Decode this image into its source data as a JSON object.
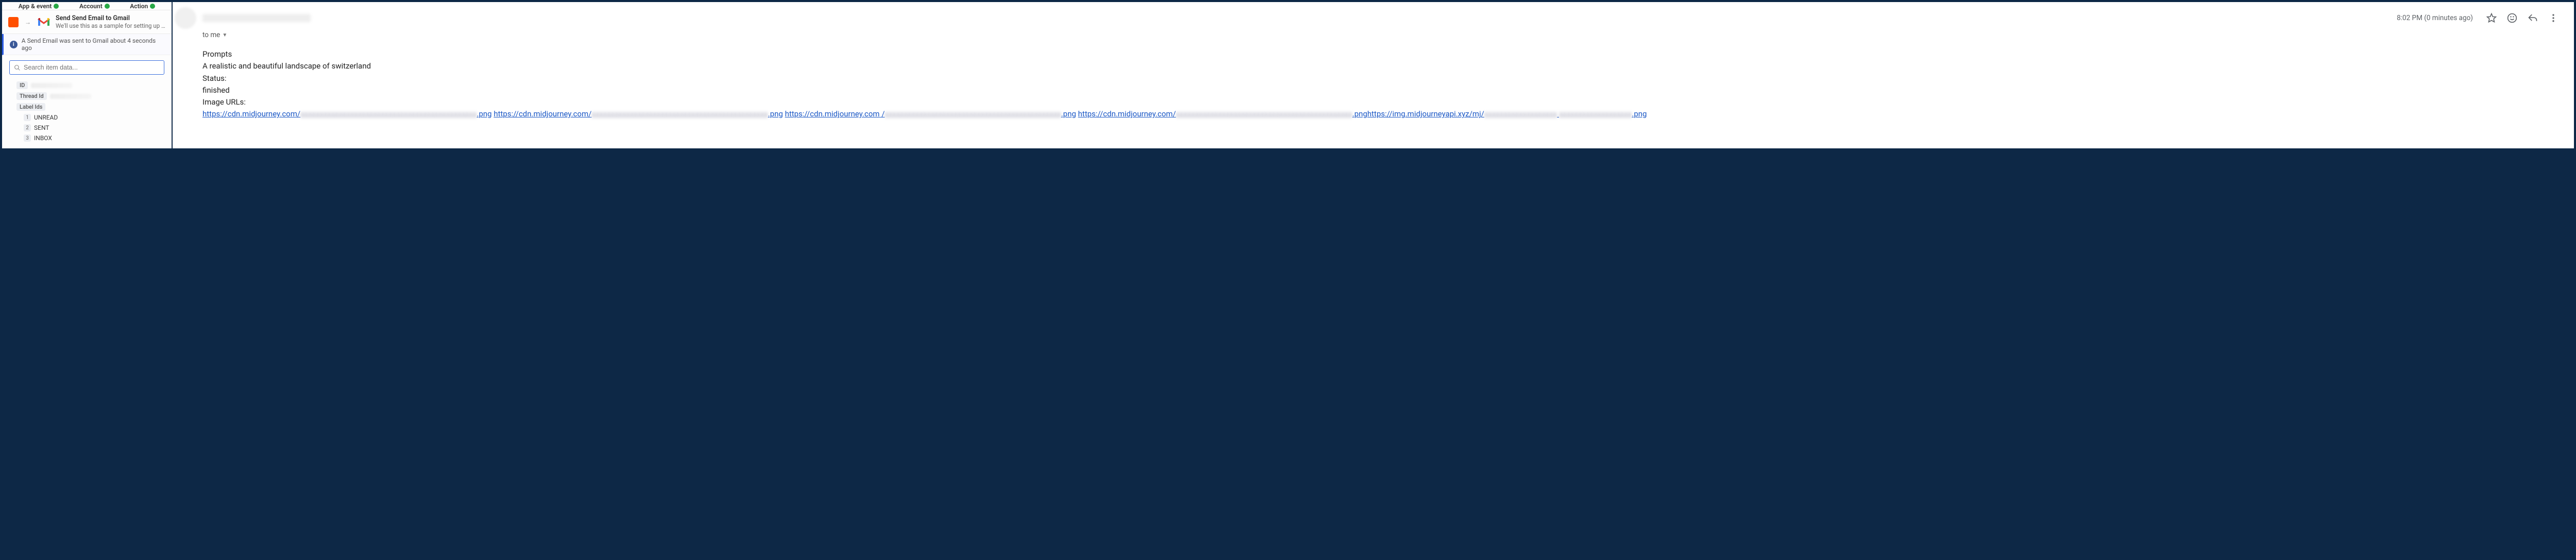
{
  "panel": {
    "tabs": {
      "t1": "App & event",
      "t2": "Account",
      "t3": "Action"
    },
    "eventCard": {
      "title": "Send Send Email to Gmail",
      "sub": "We'll use this as a sample for setting up the rest of your Zap."
    },
    "info": "A Send Email was sent to Gmail about 4 seconds ago",
    "search": {
      "placeholder": "Search item data..."
    },
    "fields": {
      "id": "ID",
      "threadId": "Thread Id",
      "labelIds": "Label Ids",
      "labels": {
        "n1": "1",
        "v1": "UNREAD",
        "n2": "2",
        "v2": "SENT",
        "n3": "3",
        "v3": "INBOX"
      }
    }
  },
  "email": {
    "timestamp": "8:02 PM (0 minutes ago)",
    "to": "to me",
    "body": {
      "l1": "Prompts",
      "l2": "A realistic and beautiful landscape of switzerland",
      "l3": "Status:",
      "l4": "finished",
      "l5": "Image URLs:",
      "url1a": "https://cdn.midjourney.com/",
      "url1b": ".png",
      "url2a": "https://cdn.midjourney.com/",
      "url2b": ".png",
      "url3a": "https://cdn.midjourney.com",
      "url3b": "/",
      "url3c": ".png",
      "url4a": "https://cdn.midjourney.com/",
      "url4b": ".png",
      "url5a": "https://img.midjourneyapi.xyz/mj/",
      "url5b": ".png"
    }
  }
}
